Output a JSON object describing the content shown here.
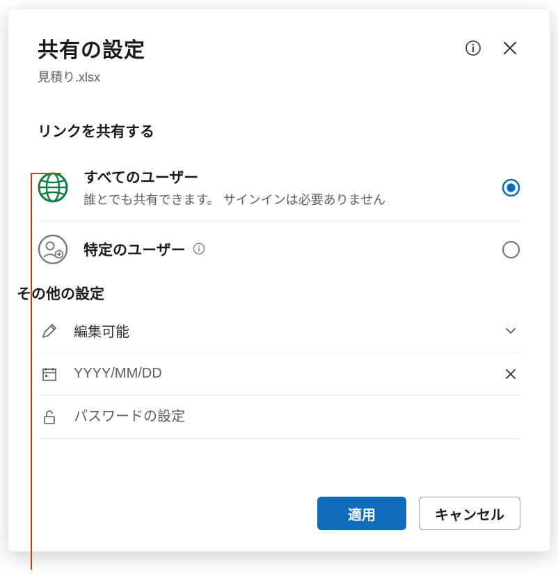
{
  "header": {
    "title": "共有の設定",
    "filename": "見積り.xlsx"
  },
  "sections": {
    "share_link_label": "リンクを共有する",
    "other_settings_label": "その他の設定"
  },
  "options": [
    {
      "icon": "globe-icon",
      "title": "すべてのユーザー",
      "desc": "誰とでも共有できます。 サインインは必要ありません",
      "selected": true
    },
    {
      "icon": "people-add-icon",
      "title": "特定のユーザー",
      "desc": "",
      "selected": false
    }
  ],
  "settings": {
    "permission_label": "編集可能",
    "date_placeholder": "YYYY/MM/DD",
    "password_placeholder": "パスワードの設定"
  },
  "buttons": {
    "apply": "適用",
    "cancel": "キャンセル"
  }
}
